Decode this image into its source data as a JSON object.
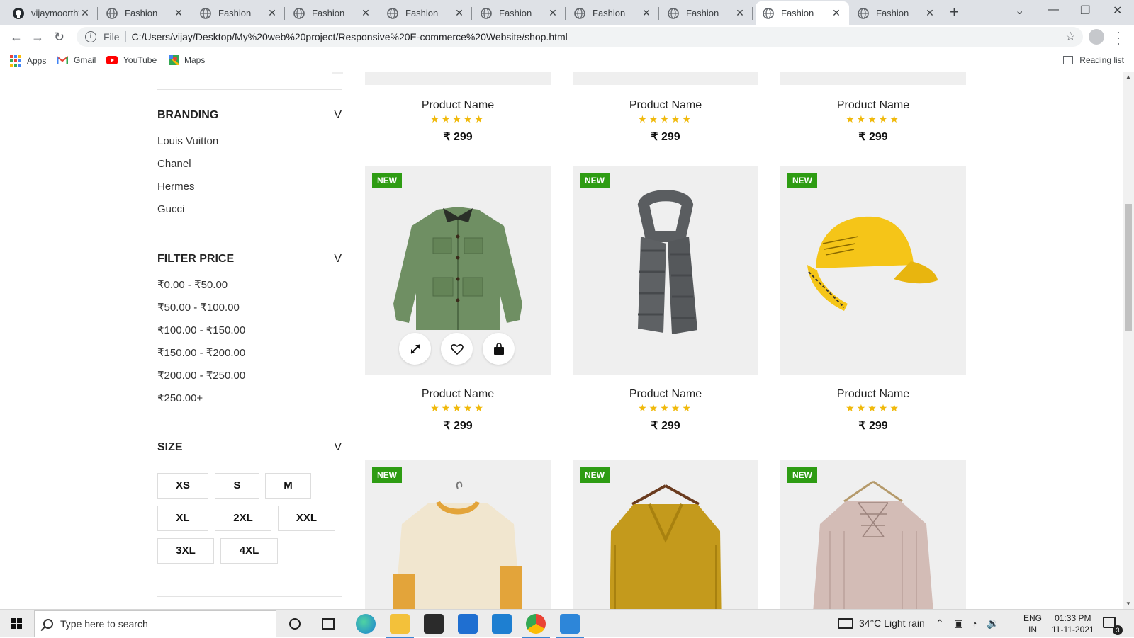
{
  "browser": {
    "tabs": [
      {
        "title": "vijaymoorthy",
        "icon": "github-icon",
        "active": false
      },
      {
        "title": "Fashion",
        "icon": "globe-icon",
        "active": false
      },
      {
        "title": "Fashion",
        "icon": "globe-icon",
        "active": false
      },
      {
        "title": "Fashion",
        "icon": "globe-icon",
        "active": false
      },
      {
        "title": "Fashion",
        "icon": "globe-icon",
        "active": false
      },
      {
        "title": "Fashion",
        "icon": "globe-icon",
        "active": false
      },
      {
        "title": "Fashion",
        "icon": "globe-icon",
        "active": false
      },
      {
        "title": "Fashion",
        "icon": "globe-icon",
        "active": false
      },
      {
        "title": "Fashion",
        "icon": "globe-icon",
        "active": true
      },
      {
        "title": "Fashion",
        "icon": "globe-icon",
        "active": false
      }
    ],
    "url_scheme": "File",
    "url": "C:/Users/vijay/Desktop/My%20web%20project/Responsive%20E-commerce%20Website/shop.html",
    "bookmarks": [
      {
        "label": "Apps",
        "icon": "apps-grid-icon"
      },
      {
        "label": "Gmail",
        "icon": "gmail-icon"
      },
      {
        "label": "YouTube",
        "icon": "youtube-icon"
      },
      {
        "label": "Maps",
        "icon": "maps-icon"
      }
    ],
    "reading_list": "Reading list"
  },
  "sidebar": {
    "branding": {
      "title": "BRANDING",
      "chevron": "V",
      "items": [
        "Louis Vuitton",
        "Chanel",
        "Hermes",
        "Gucci"
      ]
    },
    "price": {
      "title": "FILTER PRICE",
      "chevron": "V",
      "items": [
        "₹0.00 - ₹50.00",
        "₹50.00 - ₹100.00",
        "₹100.00 - ₹150.00",
        "₹150.00 - ₹200.00",
        "₹200.00 - ₹250.00",
        "₹250.00+"
      ]
    },
    "size": {
      "title": "SIZE",
      "chevron": "V",
      "options": [
        "XS",
        "S",
        "M",
        "XL",
        "2XL",
        "XXL",
        "3XL",
        "4XL"
      ]
    }
  },
  "products": {
    "badge": "NEW",
    "stars": "★★★★★",
    "rating": 5,
    "items": [
      {
        "name": "Product Name",
        "price": "₹ 299",
        "image": "hidden-top"
      },
      {
        "name": "Product Name",
        "price": "₹ 299",
        "image": "hidden-top"
      },
      {
        "name": "Product Name",
        "price": "₹ 299",
        "image": "hidden-top"
      },
      {
        "name": "Product Name",
        "price": "₹ 299",
        "image": "green-jacket",
        "badge": true
      },
      {
        "name": "Product Name",
        "price": "₹ 299",
        "image": "grey-scarf",
        "badge": true
      },
      {
        "name": "Product Name",
        "price": "₹ 299",
        "image": "yellow-cap",
        "badge": true
      },
      {
        "name": "",
        "price": "",
        "image": "cream-sweater",
        "badge": true
      },
      {
        "name": "",
        "price": "",
        "image": "mustard-sweater",
        "badge": true
      },
      {
        "name": "",
        "price": "",
        "image": "pink-sweater",
        "badge": true
      }
    ]
  },
  "taskbar": {
    "search_placeholder": "Type here to search",
    "weather": "34°C  Light rain",
    "lang_top": "ENG",
    "lang_bottom": "IN",
    "time": "01:33 PM",
    "date": "11-11-2021",
    "notifications": "3"
  },
  "colors": {
    "badge": "#2e9c13",
    "star": "#f0b90b",
    "tab_strip": "#dee1e6"
  }
}
